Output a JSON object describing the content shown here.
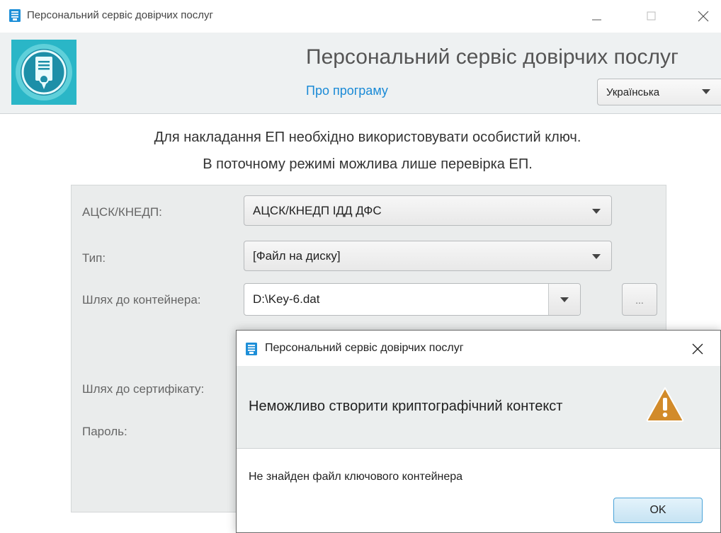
{
  "window": {
    "title": "Персональний сервіс довірчих послуг"
  },
  "header": {
    "title": "Персональний сервіс довірчих послуг",
    "about_link": "Про програму",
    "language": "Українська"
  },
  "info": {
    "line1": "Для накладання ЕП необхідно використовувати особистий ключ.",
    "line2": "В поточному режимі можлива лише перевірка ЕП."
  },
  "form": {
    "ca_label": "АЦСК/КНЕДП:",
    "ca_value": "АЦСК/КНЕДП ІДД ДФС",
    "type_label": "Тип:",
    "type_value": "[Файл на диску]",
    "container_label": "Шлях до контейнера:",
    "container_value": "D:\\Key-6.dat",
    "browse_label": "...",
    "cert_label": "Шлях до сертифікату:",
    "password_label": "Пароль:"
  },
  "dialog": {
    "title": "Персональний сервіс довірчих послуг",
    "message": "Неможливо створити криптографічний контекст",
    "detail": "Не знайден файл ключового контейнера",
    "ok_label": "OK"
  },
  "colors": {
    "accent": "#1a8ad6",
    "logo_teal": "#2ab6c7",
    "warning": "#d28b2a"
  },
  "icons": [
    "app-icon",
    "minimize-icon",
    "maximize-icon",
    "close-icon",
    "certificate-logo-icon",
    "chevron-down-icon",
    "warning-icon"
  ]
}
